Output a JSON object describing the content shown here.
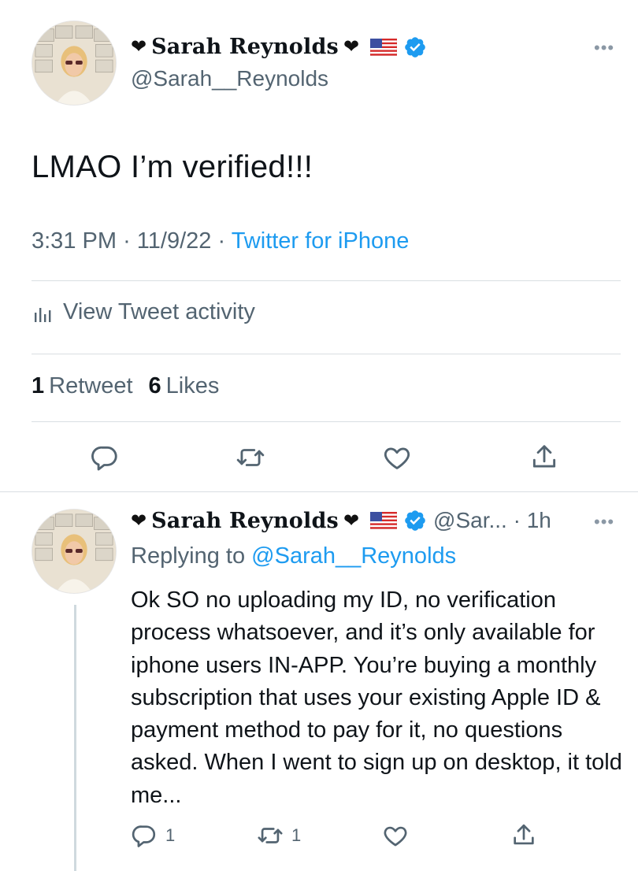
{
  "main_tweet": {
    "display_name": "Sarah Reynolds",
    "heart_left": "❤",
    "heart_right": "❤",
    "flag": "us-flag",
    "verified": "verified-badge-icon",
    "handle": "@Sarah__Reynolds",
    "more": "•••",
    "text": "LMAO I’m verified!!!",
    "time": "3:31 PM",
    "date": "11/9/22",
    "separator": "·",
    "source": "Twitter for iPhone",
    "activity_label": "View Tweet activity",
    "retweet_count": "1",
    "retweet_label": "Retweet",
    "like_count": "6",
    "like_label": "Likes"
  },
  "reply": {
    "display_name": "Sarah Reynolds",
    "heart_left": "❤",
    "heart_right": "❤",
    "handle_time": "@Sar... · 1h",
    "more": "•••",
    "replying_to_label": "Replying to",
    "replying_to_handle": "@Sarah__Reynolds",
    "text": "Ok SO no uploading my ID, no verification process whatsoever, and it’s only available for iphone users IN-APP. You’re buying a monthly subscription that uses your existing Apple ID & payment method to pay for it, no questions asked. When I went to sign up on desktop, it told me...",
    "reply_count": "1",
    "retweet_count": "1"
  },
  "colors": {
    "accent": "#1d9bf0",
    "muted": "#536471",
    "text": "#0f1419",
    "divider": "#d9dee2"
  }
}
